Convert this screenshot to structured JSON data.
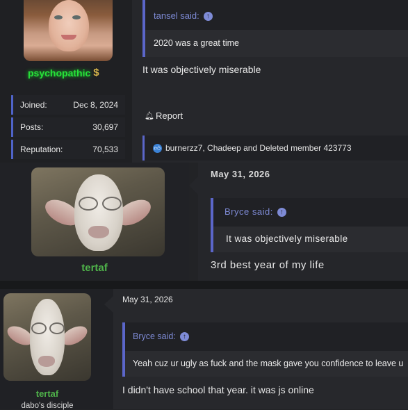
{
  "post1": {
    "username": "psychopathic",
    "badge_icon": "dollar-icon",
    "stats": [
      {
        "label": "Joined:",
        "value": "Dec 8, 2024"
      },
      {
        "label": "Posts:",
        "value": "30,697"
      },
      {
        "label": "Reputation:",
        "value": "70,533"
      }
    ],
    "quote_author": "tansel said:",
    "quote_text": "2020 was a great time",
    "body": "It was objectively miserable",
    "report_label": "Report",
    "reactions": "burnerzz7, Chadeep and Deleted member 423773"
  },
  "post2": {
    "username": "tertaf",
    "date": "May 31, 2026",
    "quote_author": "Bryce said:",
    "quote_text": "It was objectively miserable",
    "body": "3rd best year of my life"
  },
  "post3": {
    "username": "tertaf",
    "user_title": "dabo's disciple",
    "date": "May 31, 2026",
    "quote_author": "Bryce said:",
    "quote_text": "Yeah cuz ur ugly as fuck and the mask gave you confidence to leave u",
    "body": "I didn't have school that year. it was js online"
  },
  "colors": {
    "accent": "#5b66c9",
    "username_green": "#27e23a",
    "tertaf_green": "#4fb24a"
  }
}
